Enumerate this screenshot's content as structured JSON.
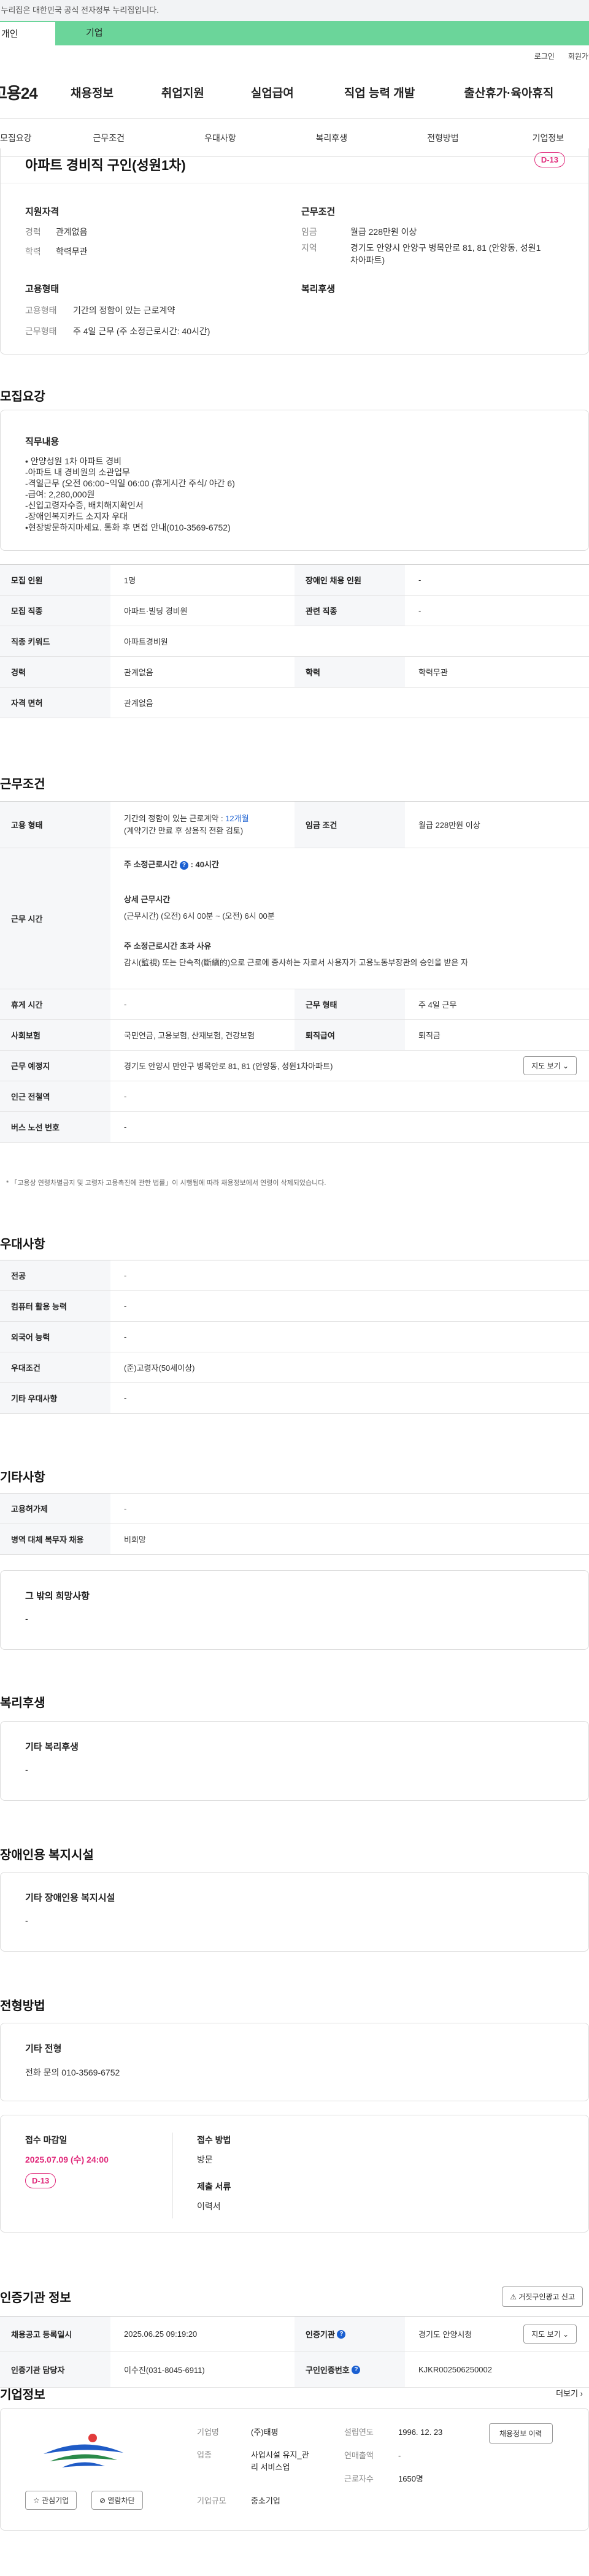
{
  "banner": {
    "text": "이 누리집은 대한민국 공식 전자정부 누리집입니다."
  },
  "top_tabs": {
    "person": "개인",
    "company": "기업"
  },
  "util": {
    "login": "로그인",
    "signup": "회원가입"
  },
  "gnb": {
    "logo": "고용24",
    "menu": [
      "채용정보",
      "취업지원",
      "실업급여",
      "직업 능력 개발",
      "출산휴가·육아휴직"
    ]
  },
  "subnav": [
    "모집요강",
    "근무조건",
    "우대사항",
    "복리후생",
    "전형방법",
    "기업정보"
  ],
  "job": {
    "title": "아파트 경비직 구인(성원1차)",
    "dday": "D-13",
    "support_title": "지원자격",
    "career_k": "경력",
    "career_v": "관계없음",
    "edu_k": "학력",
    "edu_v": "학력무관",
    "cond_title": "근무조건",
    "wage_k": "임금",
    "wage_v": "월급 228만원 이상",
    "area_k": "지역",
    "area_v1": "경기도 안양시 안양구 병목안로 81, 81 (안양동, 성원1",
    "area_v2": "차아파트)",
    "emp_title": "고용형태",
    "emp_k": "고용형태",
    "emp_v": "기간의 정함이 있는 근로계약",
    "work_k": "근무형태",
    "work_v": "주 4일 근무 (주 소정근로시간: 40시간)",
    "welfare_title": "복리후생"
  },
  "recruit": {
    "heading": "모집요강",
    "duty_title": "직무내용",
    "duty_lines": [
      "• 안양성원 1차 아파트 경비",
      "-아파트 내 경비원의 소관업무",
      "-격일근무 (오전  06:00~익일  06:00 (휴게시간 주식/ 야간 6)",
      "-급여: 2,280,000원",
      "-신입고령자수증, 배치해지확인서",
      "-장애인복지카드 소지자 우대",
      "•현장방문하지마세요. 통화 후 면접 안내(010-3569-6752)"
    ],
    "rows": [
      {
        "k1": "모집 인원",
        "v1": "1명",
        "k2": "장애인 채용 인원",
        "v2": "-"
      },
      {
        "k1": "모집 직종",
        "v1": "아파트·빌딩 경비원",
        "k2": "관련 직종",
        "v2": "-"
      },
      {
        "k1": "직종 키워드",
        "v1": "아파트경비원"
      },
      {
        "k1": "경력",
        "v1": "관계없음",
        "k2": "학력",
        "v2": "학력무관"
      },
      {
        "k1": "자격 면허",
        "v1": "관계없음"
      }
    ]
  },
  "work": {
    "heading": "근무조건",
    "emp_k": "고용 형태",
    "emp_v1_a": "기간의 정함이 있는 근로계약 : ",
    "emp_v1_b": "12개월",
    "emp_v2": "(계약기간 만료 후 상용직 전환 검토)",
    "wage_k": "임금 조건",
    "wage_v": "월급 228만원 이상",
    "time_k": "근무 시간",
    "time_weekly": "주 소정근로시간",
    "time_weekly_v": ": 40시간",
    "time_detail_title": "상세 근무시간",
    "time_detail": "(근무시간) (오전) 6시 00분 ~ (오전) 6시 00분",
    "time_over_title": "주 소정근로시간 초과 사유",
    "time_over": "감시(監視) 또는 단속적(斷續的)으로 근로에 종사하는 자로서 사용자가 고용노동부장관의 승인을 받은 자",
    "break_k": "휴게 시간",
    "break_v": "-",
    "form_k": "근무 형태",
    "form_v": "주 4일 근무",
    "ins_k": "사회보험",
    "ins_v": "국민연금, 고용보험, 산재보험, 건강보험",
    "retire_k": "퇴직급여",
    "retire_v": "퇴직금",
    "place_k": "근무 예정지",
    "place_v": "경기도 안양시 만안구 병목안로 81, 81 (안양동, 성원1차아파트)",
    "map_btn": "지도 보기 ⌄",
    "metro_k": "인근 전철역",
    "metro_v": "-",
    "bus_k": "버스 노선 번호",
    "bus_v": "-",
    "note": "* 「고용상 연령차별금지 및 고령자 고용촉진에 관한 법률」이 시행됨에 따라 채용정보에서 연령이 삭제되었습니다."
  },
  "pref": {
    "heading": "우대사항",
    "rows": [
      {
        "k": "전공",
        "v": "-"
      },
      {
        "k": "컴퓨터 활용 능력",
        "v": "-"
      },
      {
        "k": "외국어 능력",
        "v": "-"
      },
      {
        "k": "우대조건",
        "v": "(준)고령자(50세이상)"
      },
      {
        "k": "기타 우대사항",
        "v": "-"
      }
    ]
  },
  "etc": {
    "heading": "기타사항",
    "rows": [
      {
        "k": "고용허가제",
        "v": "-"
      },
      {
        "k": "병역 대체 복무자 채용",
        "v": "비희망"
      }
    ],
    "card_title": "그 밖의 희망사항",
    "card_value": "-"
  },
  "welfare": {
    "heading": "복리후생",
    "card_title": "기타 복리후생",
    "card_value": "-"
  },
  "disabled": {
    "heading": "장애인용 복지시설",
    "card_title": "기타 장애인용 복지시설",
    "card_value": "-"
  },
  "screen": {
    "heading": "전형방법",
    "card_title": "기타 전형",
    "card_value": "전화 문의 010-3569-6752",
    "deadline_title": "접수 마감일",
    "deadline_value": "2025.07.09 (수) 24:00",
    "deadline_dday": "D-13",
    "method_title": "접수 방법",
    "method_value": "방문",
    "docs_title": "제출 서류",
    "docs_value": "이력서"
  },
  "cert": {
    "heading": "인증기관 정보",
    "report_btn": "거짓구인광고 신고",
    "reg_k": "채용공고 등록일시",
    "reg_v": "2025.06.25 09:19:20",
    "org_k": "인증기관",
    "org_v": "경기도 안양시청",
    "map_btn": "지도 보기 ⌄",
    "mgr_k": "인증기관 담당자",
    "mgr_v": "이수진(031-8045-6911)",
    "auth_k": "구인인증번호",
    "auth_v": "KJKR002506250002"
  },
  "company": {
    "heading": "기업정보",
    "more": "더보기 ›",
    "fav_btn": "관심기업",
    "block_btn": "열람차단",
    "name_k": "기업명",
    "name_v": "(주)태평",
    "year_k": "설립연도",
    "year_v": "1996. 12. 23",
    "job_btn": "채용정보 이력",
    "ind_k": "업종",
    "ind_v1": "사업시설 유지_관",
    "ind_v2": "리 서비스업",
    "sales_k": "연매출액",
    "sales_v": "-",
    "staff_k": "근로자수",
    "staff_v": "1650명",
    "scale_k": "기업규모",
    "scale_v": "중소기업"
  },
  "colors": {
    "accent_green": "#6bd59a",
    "dday_pink": "#e0287a",
    "link_blue": "#1a5fd1"
  }
}
